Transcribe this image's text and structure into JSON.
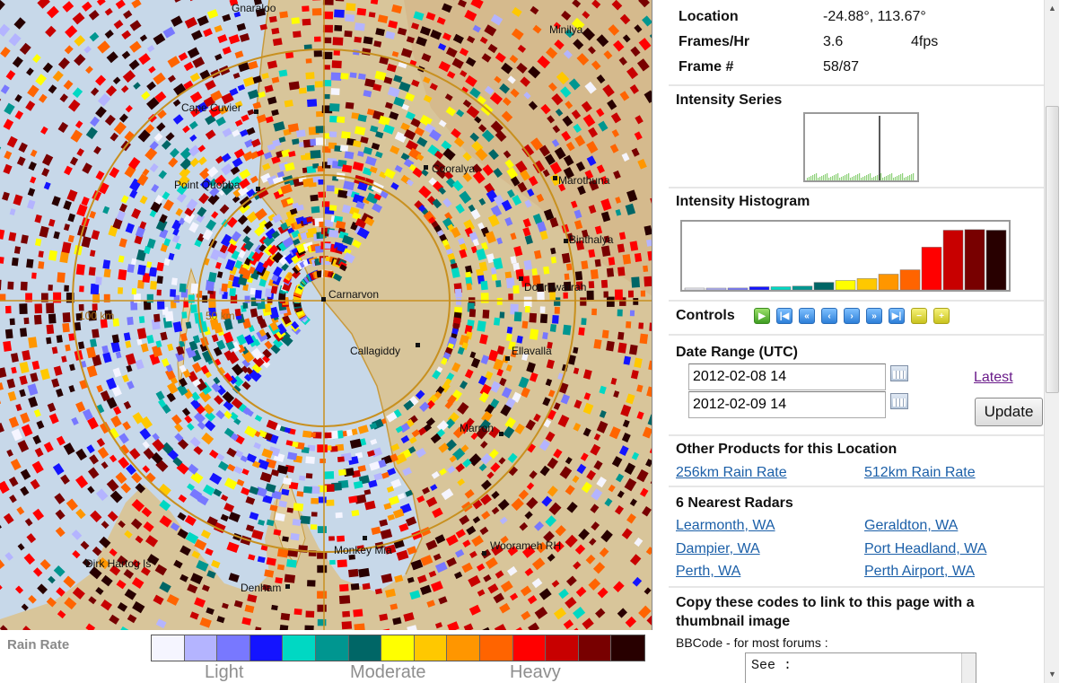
{
  "map": {
    "towns": [
      {
        "name": "Gnaraloo"
      },
      {
        "name": "Cape Cuvier"
      },
      {
        "name": "Point Quobba"
      },
      {
        "name": "Cooralya"
      },
      {
        "name": "Carnarvon"
      },
      {
        "name": "Callagiddy"
      },
      {
        "name": "Doorawarrah"
      },
      {
        "name": "Ellavalla"
      },
      {
        "name": "Minilya"
      },
      {
        "name": "Marothuna"
      },
      {
        "name": "Binthalya"
      },
      {
        "name": "Marron"
      },
      {
        "name": "Monkey Mia"
      },
      {
        "name": "Woorameh RH"
      },
      {
        "name": "Dirk Hartog Is"
      },
      {
        "name": "Denham"
      }
    ],
    "range_labels": [
      "100 km",
      "50 km"
    ]
  },
  "legend": {
    "title": "Rain Rate",
    "colors": [
      "#f5f5ff",
      "#b4b4ff",
      "#7878ff",
      "#1414ff",
      "#00d8c3",
      "#009690",
      "#006666",
      "#ffff00",
      "#ffc800",
      "#ff9600",
      "#ff6400",
      "#ff0000",
      "#c80000",
      "#780000",
      "#280000"
    ],
    "words": [
      "Light",
      "Moderate",
      "Heavy"
    ]
  },
  "info": {
    "location_label": "Location",
    "location_value": "-24.88°, 113.67°",
    "frames_label": "Frames/Hr",
    "frames_value": "3.6",
    "fps_value": "4fps",
    "frame_label": "Frame #",
    "frame_value": "58/87"
  },
  "intensity_series": {
    "title": "Intensity Series"
  },
  "intensity_histogram": {
    "title": "Intensity Histogram",
    "bars": [
      {
        "value": 0.02,
        "color": "#f5f5ff"
      },
      {
        "value": 0.02,
        "color": "#b4b4ff"
      },
      {
        "value": 0.03,
        "color": "#7878ff"
      },
      {
        "value": 0.05,
        "color": "#1414ff"
      },
      {
        "value": 0.05,
        "color": "#00d8c3"
      },
      {
        "value": 0.06,
        "color": "#009690"
      },
      {
        "value": 0.12,
        "color": "#006666"
      },
      {
        "value": 0.15,
        "color": "#ffff00"
      },
      {
        "value": 0.18,
        "color": "#ffc800"
      },
      {
        "value": 0.25,
        "color": "#ff9600"
      },
      {
        "value": 0.32,
        "color": "#ff6400"
      },
      {
        "value": 0.68,
        "color": "#ff0000"
      },
      {
        "value": 0.95,
        "color": "#c80000"
      },
      {
        "value": 0.96,
        "color": "#780000"
      },
      {
        "value": 0.95,
        "color": "#280000"
      }
    ]
  },
  "controls": {
    "title": "Controls",
    "buttons": [
      {
        "icon": "play-icon",
        "glyph": "▶",
        "kind": "green"
      },
      {
        "icon": "first-frame-icon",
        "glyph": "|◀",
        "kind": "blue"
      },
      {
        "icon": "rewind-icon",
        "glyph": "«",
        "kind": "blue"
      },
      {
        "icon": "previous-frame-icon",
        "glyph": "‹",
        "kind": "blue"
      },
      {
        "icon": "next-frame-icon",
        "glyph": "›",
        "kind": "blue"
      },
      {
        "icon": "fast-forward-icon",
        "glyph": "»",
        "kind": "blue"
      },
      {
        "icon": "last-frame-icon",
        "glyph": "▶|",
        "kind": "blue"
      },
      {
        "icon": "slower-icon",
        "glyph": "−",
        "kind": "yellow"
      },
      {
        "icon": "faster-icon",
        "glyph": "+",
        "kind": "yellow"
      }
    ]
  },
  "date_range": {
    "title": "Date Range (UTC)",
    "start": "2012-02-08 14",
    "end": "2012-02-09 14",
    "latest_label": "Latest",
    "update_label": "Update"
  },
  "other_products": {
    "title": "Other Products for this Location",
    "links": [
      "256km Rain Rate",
      "512km Rain Rate"
    ]
  },
  "nearest_radars": {
    "title": "6 Nearest Radars",
    "links": [
      "Learmonth, WA",
      "Geraldton, WA",
      "Dampier, WA",
      "Port Headland, WA",
      "Perth, WA",
      "Perth Airport, WA"
    ]
  },
  "codes": {
    "title": "Copy these codes to link to this page with a thumbnail image",
    "bbcode_label": "BBCode - for most forums :",
    "bbcode_text": "See :"
  }
}
